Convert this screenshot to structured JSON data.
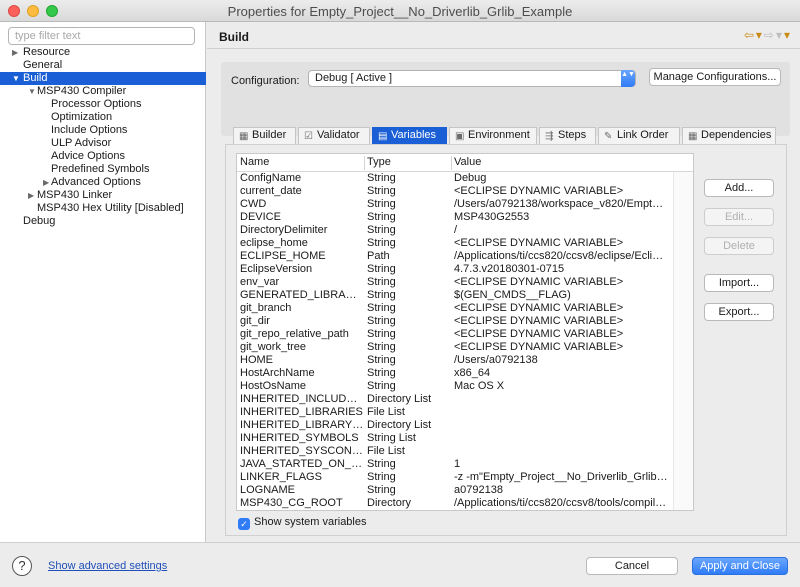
{
  "window": {
    "title": "Properties for Empty_Project__No_Driverlib_Grlib_Example"
  },
  "left": {
    "filter_placeholder": "type filter text",
    "tree": [
      {
        "label": "Resource",
        "depth": 0,
        "twisty": "▶",
        "selected": false
      },
      {
        "label": "General",
        "depth": 0,
        "twisty": "",
        "selected": false
      },
      {
        "label": "Build",
        "depth": 0,
        "twisty": "▼",
        "selected": true
      },
      {
        "label": "MSP430 Compiler",
        "depth": 1,
        "twisty": "▼",
        "selected": false
      },
      {
        "label": "Processor Options",
        "depth": 2,
        "twisty": "",
        "selected": false
      },
      {
        "label": "Optimization",
        "depth": 2,
        "twisty": "",
        "selected": false
      },
      {
        "label": "Include Options",
        "depth": 2,
        "twisty": "",
        "selected": false
      },
      {
        "label": "ULP Advisor",
        "depth": 2,
        "twisty": "",
        "selected": false
      },
      {
        "label": "Advice Options",
        "depth": 2,
        "twisty": "",
        "selected": false
      },
      {
        "label": "Predefined Symbols",
        "depth": 2,
        "twisty": "",
        "selected": false
      },
      {
        "label": "Advanced Options",
        "depth": 2,
        "twisty": "▶",
        "selected": false
      },
      {
        "label": "MSP430 Linker",
        "depth": 1,
        "twisty": "▶",
        "selected": false
      },
      {
        "label": "MSP430 Hex Utility  [Disabled]",
        "depth": 1,
        "twisty": "",
        "selected": false
      },
      {
        "label": "Debug",
        "depth": 0,
        "twisty": "",
        "selected": false
      }
    ]
  },
  "page": {
    "title": "Build",
    "nav_back": "⇦▾",
    "nav_forward": "⇨▾",
    "nav_menu": "▾"
  },
  "config": {
    "label": "Configuration:",
    "value": "Debug  [ Active ]",
    "caret": "▲▼",
    "manage_label": "Manage Configurations..."
  },
  "tabs": [
    {
      "label": "Builder",
      "icon": "▦",
      "icon_name": "builder-icon",
      "active": false
    },
    {
      "label": "Validator",
      "icon": "☑",
      "icon_name": "validator-icon",
      "active": false
    },
    {
      "label": "Variables",
      "icon": "▤",
      "icon_name": "variables-icon",
      "active": true
    },
    {
      "label": "Environment",
      "icon": "▣",
      "icon_name": "environment-icon",
      "active": false
    },
    {
      "label": "Steps",
      "icon": "⇶",
      "icon_name": "steps-icon",
      "active": false
    },
    {
      "label": "Link Order",
      "icon": "✎",
      "icon_name": "link-order-icon",
      "active": false
    },
    {
      "label": "Dependencies",
      "icon": "▦",
      "icon_name": "dependencies-icon",
      "active": false
    }
  ],
  "table": {
    "headers": {
      "name": "Name",
      "type": "Type",
      "value": "Value"
    },
    "rows": [
      {
        "name": "ConfigName",
        "type": "String",
        "value": "Debug"
      },
      {
        "name": "current_date",
        "type": "String",
        "value": "<ECLIPSE DYNAMIC VARIABLE>"
      },
      {
        "name": "CWD",
        "type": "String",
        "value": "/Users/a0792138/workspace_v820/Empty_P..."
      },
      {
        "name": "DEVICE",
        "type": "String",
        "value": "MSP430G2553"
      },
      {
        "name": "DirectoryDelimiter",
        "type": "String",
        "value": "/"
      },
      {
        "name": "eclipse_home",
        "type": "String",
        "value": "<ECLIPSE DYNAMIC VARIABLE>"
      },
      {
        "name": "ECLIPSE_HOME",
        "type": "Path",
        "value": "/Applications/ti/ccs820/ccsv8/eclipse/Eclips..."
      },
      {
        "name": "EclipseVersion",
        "type": "String",
        "value": "4.7.3.v20180301-0715"
      },
      {
        "name": "env_var",
        "type": "String",
        "value": "<ECLIPSE DYNAMIC VARIABLE>"
      },
      {
        "name": "GENERATED_LIBRARIES",
        "type": "String",
        "value": "$(GEN_CMDS__FLAG)"
      },
      {
        "name": "git_branch",
        "type": "String",
        "value": "<ECLIPSE DYNAMIC VARIABLE>"
      },
      {
        "name": "git_dir",
        "type": "String",
        "value": "<ECLIPSE DYNAMIC VARIABLE>"
      },
      {
        "name": "git_repo_relative_path",
        "type": "String",
        "value": "<ECLIPSE DYNAMIC VARIABLE>"
      },
      {
        "name": "git_work_tree",
        "type": "String",
        "value": "<ECLIPSE DYNAMIC VARIABLE>"
      },
      {
        "name": "HOME",
        "type": "String",
        "value": "/Users/a0792138"
      },
      {
        "name": "HostArchName",
        "type": "String",
        "value": "x86_64"
      },
      {
        "name": "HostOsName",
        "type": "String",
        "value": "Mac OS X"
      },
      {
        "name": "INHERITED_INCLUDE_PATH",
        "type": "Directory List",
        "value": ""
      },
      {
        "name": "INHERITED_LIBRARIES",
        "type": "File List",
        "value": ""
      },
      {
        "name": "INHERITED_LIBRARY_PATH",
        "type": "Directory List",
        "value": ""
      },
      {
        "name": "INHERITED_SYMBOLS",
        "type": "String List",
        "value": ""
      },
      {
        "name": "INHERITED_SYSCONFIG_...",
        "type": "File List",
        "value": ""
      },
      {
        "name": "JAVA_STARTED_ON_FIRS...",
        "type": "String",
        "value": "1"
      },
      {
        "name": "LINKER_FLAGS",
        "type": "String",
        "value": "-z -m\"Empty_Project__No_Driverlib_Grlib_Exa..."
      },
      {
        "name": "LOGNAME",
        "type": "String",
        "value": "a0792138"
      },
      {
        "name": "MSP430_CG_ROOT",
        "type": "Directory",
        "value": "/Applications/ti/ccs820/ccsv8/tools/compiler..."
      }
    ]
  },
  "side_buttons": {
    "add": "Add...",
    "edit": "Edit...",
    "delete": "Delete",
    "import": "Import...",
    "export": "Export..."
  },
  "show_system": {
    "label": "Show system variables",
    "checked": true,
    "check_glyph": "✓"
  },
  "footer": {
    "help": "?",
    "advanced": "Show advanced settings",
    "cancel": "Cancel",
    "apply": "Apply and Close"
  }
}
